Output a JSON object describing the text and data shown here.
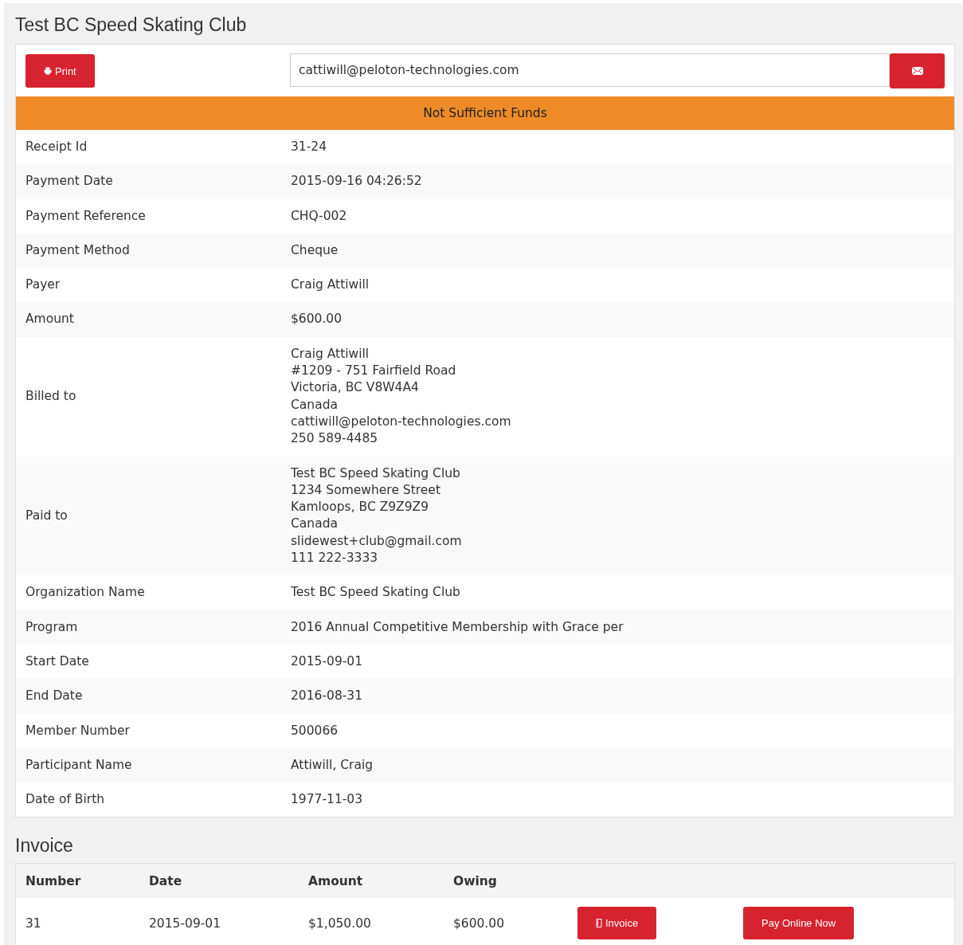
{
  "title": "Test BC Speed Skating Club",
  "print_button": {
    "label": "Print"
  },
  "email_field": {
    "value": "cattiwill@peloton-technologies.com"
  },
  "status_banner": "Not Sufficient Funds",
  "details": [
    {
      "label": "Receipt Id",
      "lines": [
        "31-24"
      ]
    },
    {
      "label": "Payment Date",
      "lines": [
        "2015-09-16 04:26:52"
      ]
    },
    {
      "label": "Payment Reference",
      "lines": [
        "CHQ-002"
      ]
    },
    {
      "label": "Payment Method",
      "lines": [
        "Cheque"
      ]
    },
    {
      "label": "Payer",
      "lines": [
        "Craig Attiwill"
      ]
    },
    {
      "label": "Amount",
      "lines": [
        "$600.00"
      ]
    },
    {
      "label": "Billed to",
      "lines": [
        "Craig Attiwill",
        "#1209 - 751 Fairfield Road",
        "Victoria, BC V8W4A4",
        "Canada",
        "cattiwill@peloton-technologies.com",
        "250 589-4485"
      ]
    },
    {
      "label": "Paid to",
      "lines": [
        "Test BC Speed Skating Club",
        "1234 Somewhere Street",
        "Kamloops, BC Z9Z9Z9",
        "Canada",
        "slidewest+club@gmail.com",
        "111 222-3333"
      ]
    },
    {
      "label": "Organization Name",
      "lines": [
        "Test BC Speed Skating Club"
      ]
    },
    {
      "label": "Program",
      "lines": [
        "2016 Annual Competitive Membership with Grace per"
      ]
    },
    {
      "label": "Start Date",
      "lines": [
        "2015-09-01"
      ]
    },
    {
      "label": "End Date",
      "lines": [
        "2016-08-31"
      ]
    },
    {
      "label": "Member Number",
      "lines": [
        "500066"
      ]
    },
    {
      "label": "Participant Name",
      "lines": [
        "Attiwill, Craig"
      ]
    },
    {
      "label": "Date of Birth",
      "lines": [
        "1977-11-03"
      ]
    }
  ],
  "invoice": {
    "title": "Invoice",
    "columns": [
      "Number",
      "Date",
      "Amount",
      "Owing"
    ],
    "rows": [
      {
        "cells": [
          "31",
          "2015-09-01",
          "$1,050.00",
          "$600.00"
        ],
        "invoice_button": "Invoice",
        "pay_button": "Pay Online Now"
      }
    ]
  }
}
